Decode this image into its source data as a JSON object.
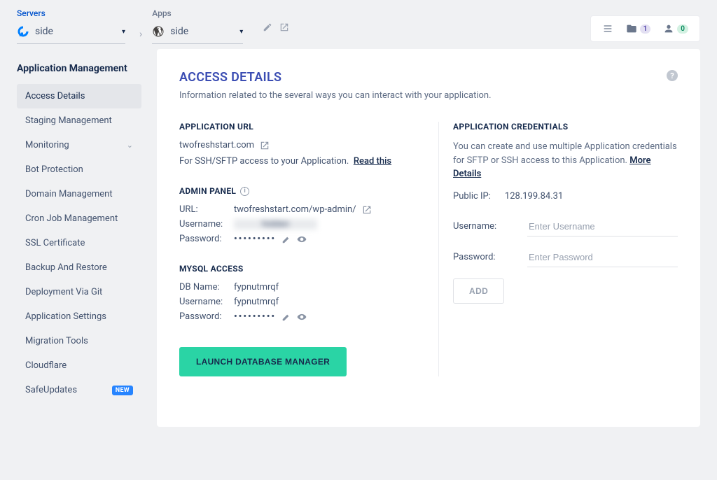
{
  "topbar": {
    "servers_label": "Servers",
    "server_value": "side",
    "apps_label": "Apps",
    "app_value": "side"
  },
  "top_right": {
    "folder_badge": "1",
    "user_badge": "0"
  },
  "sidebar": {
    "title": "Application Management",
    "items": [
      {
        "label": "Access Details",
        "active": true
      },
      {
        "label": "Staging Management"
      },
      {
        "label": "Monitoring",
        "expandable": true
      },
      {
        "label": "Bot Protection"
      },
      {
        "label": "Domain Management"
      },
      {
        "label": "Cron Job Management"
      },
      {
        "label": "SSL Certificate"
      },
      {
        "label": "Backup And Restore"
      },
      {
        "label": "Deployment Via Git"
      },
      {
        "label": "Application Settings"
      },
      {
        "label": "Migration Tools"
      },
      {
        "label": "Cloudflare"
      },
      {
        "label": "SafeUpdates",
        "new": true
      }
    ],
    "new_badge": "NEW"
  },
  "panel": {
    "title": "ACCESS DETAILS",
    "subtitle": "Information related to the several ways you can interact with your application.",
    "app_url_h": "APPLICATION URL",
    "app_url": "twofreshstart.com",
    "app_url_note": "For SSH/SFTP access to your Application.",
    "read_this": "Read this",
    "admin_h": "ADMIN PANEL",
    "admin_url_label": "URL:",
    "admin_url": "twofreshstart.com/wp-admin/",
    "admin_user_label": "Username:",
    "admin_pass_label": "Password:",
    "admin_pass_dots": "•••••••••",
    "mysql_h": "MYSQL ACCESS",
    "mysql_db_label": "DB Name:",
    "mysql_db": "fypnutmrqf",
    "mysql_user_label": "Username:",
    "mysql_user": "fypnutmrqf",
    "mysql_pass_label": "Password:",
    "mysql_pass_dots": "•••••••••",
    "launch_btn": "LAUNCH DATABASE MANAGER",
    "cred_h": "APPLICATION CREDENTIALS",
    "cred_desc": "You can create and use multiple Application credentials for SFTP or SSH access to this Application.",
    "more_details": "More Details",
    "public_ip_label": "Public IP:",
    "public_ip": "128.199.84.31",
    "cred_user_label": "Username:",
    "cred_user_ph": "Enter Username",
    "cred_pass_label": "Password:",
    "cred_pass_ph": "Enter Password",
    "add_btn": "ADD"
  }
}
